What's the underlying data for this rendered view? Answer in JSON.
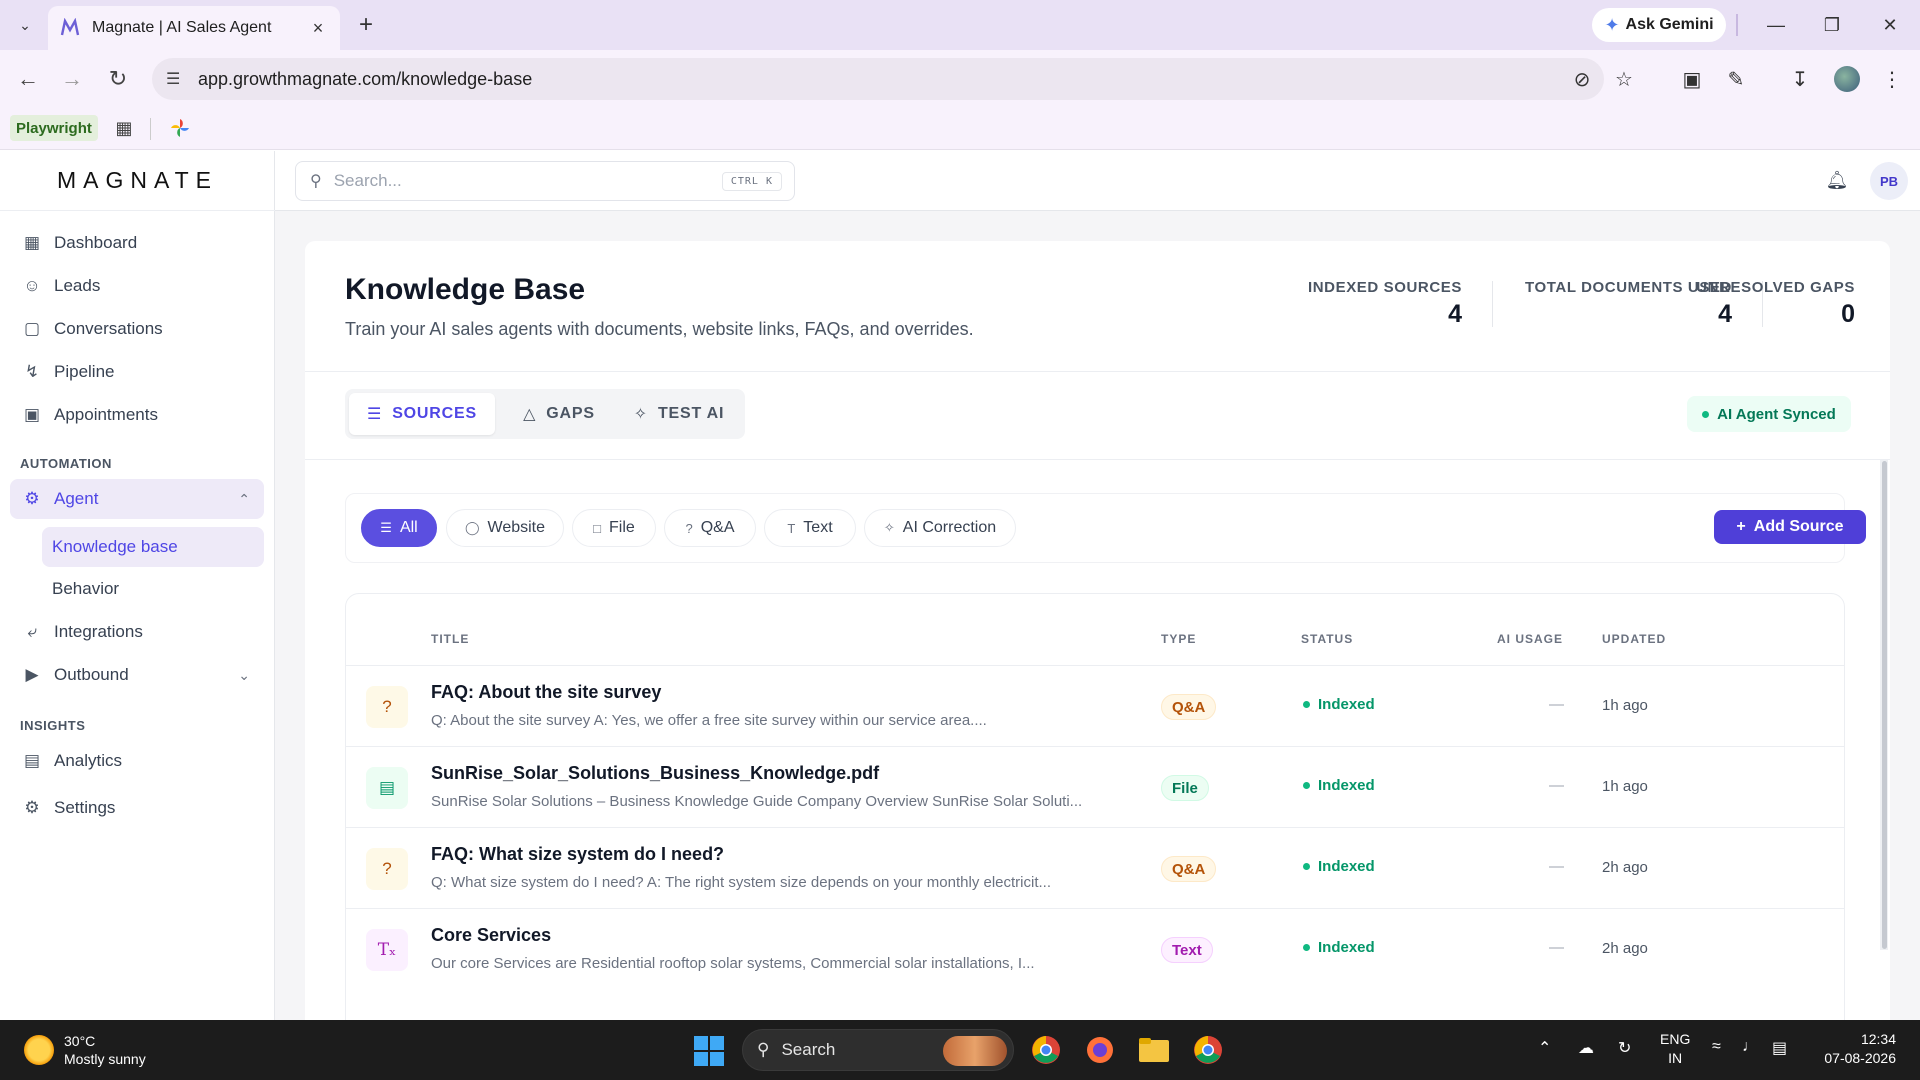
{
  "browser": {
    "tab_title": "Magnate | AI Sales Agent",
    "new_tab": "+",
    "gemini_label": "Ask Gemini",
    "url": "app.growthmagnate.com/knowledge-base",
    "bookmarks": {
      "playwright": "Playwright"
    }
  },
  "app": {
    "logo": "MAGNATE",
    "search_placeholder": "Search...",
    "search_shortcut": "CTRL K",
    "avatar_initials": "PB"
  },
  "sidebar": {
    "items": [
      {
        "label": "Dashboard",
        "icon": "dashboard-icon"
      },
      {
        "label": "Leads",
        "icon": "users-icon"
      },
      {
        "label": "Conversations",
        "icon": "chat-icon"
      },
      {
        "label": "Pipeline",
        "icon": "pipeline-icon"
      },
      {
        "label": "Appointments",
        "icon": "calendar-icon"
      }
    ],
    "automation_label": "AUTOMATION",
    "agent_label": "Agent",
    "agent_sub": [
      "Knowledge base",
      "Behavior"
    ],
    "integrations_label": "Integrations",
    "outbound_label": "Outbound",
    "insights_label": "INSIGHTS",
    "analytics_label": "Analytics",
    "settings_label": "Settings"
  },
  "page": {
    "title": "Knowledge Base",
    "subtitle": "Train your AI sales agents with documents, website links, FAQs, and overrides.",
    "stats": [
      {
        "label": "INDEXED SOURCES",
        "value": "4"
      },
      {
        "label": "TOTAL DOCUMENTS USED",
        "value": "4"
      },
      {
        "label": "UNRESOLVED GAPS",
        "value": "0"
      }
    ],
    "tabs": [
      "SOURCES",
      "GAPS",
      "TEST AI"
    ],
    "synced_label": "AI Agent Synced",
    "filters": [
      "All",
      "Website",
      "File",
      "Q&A",
      "Text",
      "AI Correction"
    ],
    "add_source": "Add Source",
    "columns": [
      "TITLE",
      "TYPE",
      "STATUS",
      "AI USAGE",
      "UPDATED"
    ],
    "rows": [
      {
        "title": "FAQ: About the site survey",
        "preview": "Q: About the site survey A: Yes, we offer a free site survey within our service area....",
        "type": "Q&A",
        "status": "Indexed",
        "usage": "—",
        "updated": "1h ago",
        "icon": "question-icon"
      },
      {
        "title": "SunRise_Solar_Solutions_Business_Knowledge.pdf",
        "preview": "SunRise Solar Solutions – Business Knowledge Guide Company Overview SunRise Solar Soluti...",
        "type": "File",
        "status": "Indexed",
        "usage": "—",
        "updated": "1h ago",
        "icon": "file-icon"
      },
      {
        "title": "FAQ: What size system do I need?",
        "preview": "Q: What size system do I need? A: The right system size depends on your monthly electricit...",
        "type": "Q&A",
        "status": "Indexed",
        "usage": "—",
        "updated": "2h ago",
        "icon": "question-icon"
      },
      {
        "title": "Core Services",
        "preview": "Our core Services are Residential rooftop solar systems, Commercial solar installations, I...",
        "type": "Text",
        "status": "Indexed",
        "usage": "—",
        "updated": "2h ago",
        "icon": "text-icon"
      }
    ]
  },
  "taskbar": {
    "temp": "30°C",
    "weather": "Mostly sunny",
    "search": "Search",
    "lang1": "ENG",
    "lang2": "IN",
    "time": "12:34",
    "date": "07-08-2026"
  },
  "colors": {
    "accent": "#4f46e5",
    "success": "#059669",
    "chrome_bg": "#f8f2fc"
  }
}
